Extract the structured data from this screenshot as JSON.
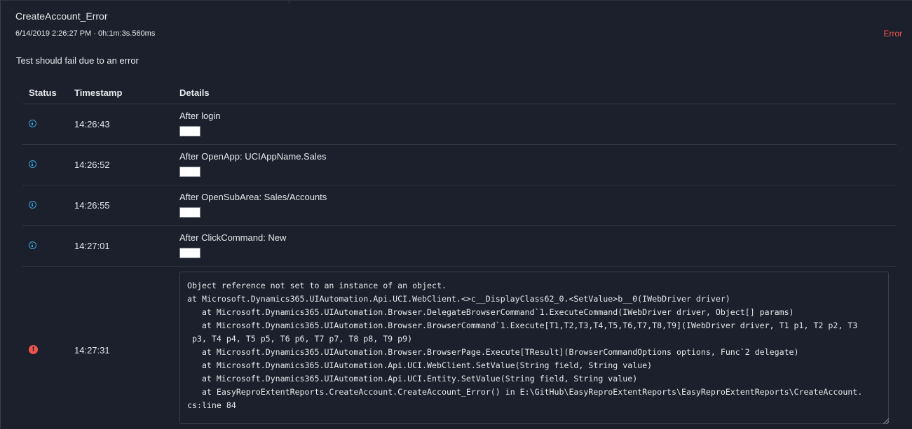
{
  "test": {
    "name": "CreateAccount_Error",
    "meta": "6/14/2019 2:26:27 PM · 0h:1m:3s.560ms",
    "status": "Error",
    "description": "Test should fail due to an error"
  },
  "table": {
    "headers": {
      "status": "Status",
      "timestamp": "Timestamp",
      "details": "Details"
    },
    "rows": [
      {
        "status_icon": "info-icon",
        "time": "14:26:43",
        "detail": "After login"
      },
      {
        "status_icon": "info-icon",
        "time": "14:26:52",
        "detail": "After OpenApp: UCIAppName.Sales"
      },
      {
        "status_icon": "info-icon",
        "time": "14:26:55",
        "detail": "After OpenSubArea: Sales/Accounts"
      },
      {
        "status_icon": "info-icon",
        "time": "14:27:01",
        "detail": "After ClickCommand: New"
      }
    ],
    "error_row": {
      "status_icon": "error-icon",
      "icon_glyph": "!",
      "time": "14:27:31",
      "stack_trace": "Object reference not set to an instance of an object.\nat Microsoft.Dynamics365.UIAutomation.Api.UCI.WebClient.<>c__DisplayClass62_0.<SetValue>b__0(IWebDriver driver)\n   at Microsoft.Dynamics365.UIAutomation.Browser.DelegateBrowserCommand`1.ExecuteCommand(IWebDriver driver, Object[] params)\n   at Microsoft.Dynamics365.UIAutomation.Browser.BrowserCommand`1.Execute[T1,T2,T3,T4,T5,T6,T7,T8,T9](IWebDriver driver, T1 p1, T2 p2, T3\n p3, T4 p4, T5 p5, T6 p6, T7 p7, T8 p8, T9 p9)\n   at Microsoft.Dynamics365.UIAutomation.Browser.BrowserPage.Execute[TResult](BrowserCommandOptions options, Func`2 delegate)\n   at Microsoft.Dynamics365.UIAutomation.Api.UCI.WebClient.SetValue(String field, String value)\n   at Microsoft.Dynamics365.UIAutomation.Api.UCI.Entity.SetValue(String field, String value)\n   at EasyReproExtentReports.CreateAccount.CreateAccount_Error() in E:\\GitHub\\EasyReproExtentReports\\EasyReproExtentReports\\CreateAccount.\ncs:line 84"
    }
  },
  "colors": {
    "background": "#1b202c",
    "error": "#f0554b",
    "info": "#3aa5dc",
    "text": "#e6e8ec"
  }
}
